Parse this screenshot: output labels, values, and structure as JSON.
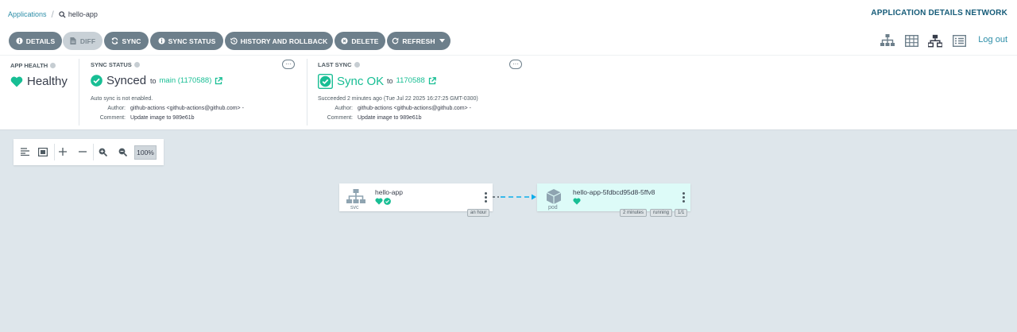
{
  "breadcrumb": {
    "root": "Applications",
    "current": "hello-app"
  },
  "page_title": "APPLICATION DETAILS NETWORK",
  "toolbar": {
    "details": "DETAILS",
    "diff": "DIFF",
    "sync": "SYNC",
    "sync_status": "SYNC STATUS",
    "history": "HISTORY AND ROLLBACK",
    "delete": "DELETE",
    "refresh": "REFRESH",
    "logout": "Log out"
  },
  "view_icons": [
    "tree-view-icon",
    "pods-view-icon",
    "network-view-icon",
    "list-view-icon"
  ],
  "app_health": {
    "label": "APP HEALTH",
    "value": "Healthy"
  },
  "sync_status": {
    "label": "SYNC STATUS",
    "value": "Synced",
    "to_text": "to",
    "revision": "main (1170588)",
    "auto_sync": "Auto sync is not enabled.",
    "author_label": "Author:",
    "author": "github-actions <github-actions@github.com> -",
    "comment_label": "Comment:",
    "comment": "Update image to 989e61b"
  },
  "last_sync": {
    "label": "LAST SYNC",
    "value": "Sync OK",
    "to_text": "to",
    "revision": "1170588",
    "succeeded": "Succeeded 2 minutes ago (Tue Jul 22 2025 16:27:25 GMT-0300)",
    "author_label": "Author:",
    "author": "github-actions <github-actions@github.com> -",
    "comment_label": "Comment:",
    "comment": "Update image to 989e61b"
  },
  "zoom": {
    "level": "100%"
  },
  "nodes": {
    "svc": {
      "name": "hello-app",
      "kind": "svc",
      "age": "an hour"
    },
    "pod": {
      "name": "hello-app-5fdbcd95d8-5ffv8",
      "kind": "pod",
      "age": "2 minutes",
      "status": "running",
      "ready": "1/1"
    }
  },
  "colors": {
    "accent": "#18be94",
    "link": "#2d8ea8",
    "button": "#6d7f8b",
    "edge": "#0dadea"
  }
}
